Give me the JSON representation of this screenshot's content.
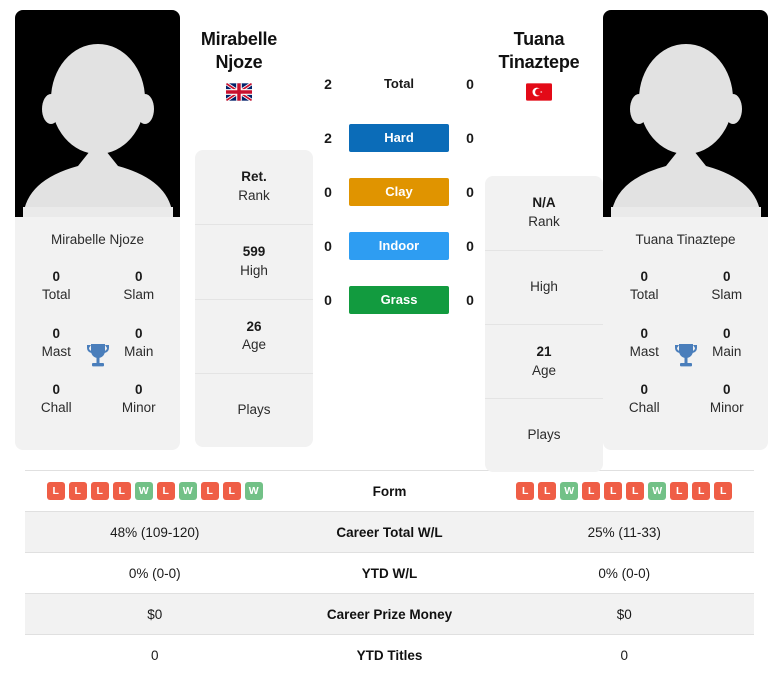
{
  "players": {
    "left": {
      "headline_name": "Mirabelle Njoze",
      "card_name": "Mirabelle Njoze",
      "flag": "gb-flag-icon",
      "flag_country": "United Kingdom",
      "avatar": "player-avatar-placeholder",
      "titles": [
        {
          "value": "0",
          "label": "Total"
        },
        {
          "value": "0",
          "label": "Slam"
        },
        {
          "value": "0",
          "label": "Mast"
        },
        {
          "value": "0",
          "label": "Main"
        },
        {
          "value": "0",
          "label": "Chall"
        },
        {
          "value": "0",
          "label": "Minor"
        }
      ],
      "rank_rows": [
        {
          "value": "Ret.",
          "label": "Rank"
        },
        {
          "value": "599",
          "label": "High"
        },
        {
          "value": "26",
          "label": "Age"
        },
        {
          "value": "",
          "label": "Plays"
        }
      ]
    },
    "right": {
      "headline_name": "Tuana Tinaztepe",
      "card_name": "Tuana Tinaztepe",
      "flag": "tr-flag-icon",
      "flag_country": "Turkey",
      "avatar": "player-avatar-placeholder",
      "titles": [
        {
          "value": "0",
          "label": "Total"
        },
        {
          "value": "0",
          "label": "Slam"
        },
        {
          "value": "0",
          "label": "Mast"
        },
        {
          "value": "0",
          "label": "Main"
        },
        {
          "value": "0",
          "label": "Chall"
        },
        {
          "value": "0",
          "label": "Minor"
        }
      ],
      "rank_rows": [
        {
          "value": "N/A",
          "label": "Rank"
        },
        {
          "value": "",
          "label": "High"
        },
        {
          "value": "21",
          "label": "Age"
        },
        {
          "value": "",
          "label": "Plays"
        }
      ]
    }
  },
  "surfaces": [
    {
      "label": "Total",
      "left": "2",
      "right": "0",
      "color": "transparent",
      "text_color": "#1a1a1a"
    },
    {
      "label": "Hard",
      "left": "2",
      "right": "0",
      "color": "#0b6cb8",
      "text_color": "#ffffff"
    },
    {
      "label": "Clay",
      "left": "0",
      "right": "0",
      "color": "#e09400",
      "text_color": "#ffffff"
    },
    {
      "label": "Indoor",
      "left": "0",
      "right": "0",
      "color": "#2e9df2",
      "text_color": "#ffffff"
    },
    {
      "label": "Grass",
      "left": "0",
      "right": "0",
      "color": "#129b3f",
      "text_color": "#ffffff"
    }
  ],
  "trophy_icon": "trophy-icon",
  "trophy_color": "#4a7ebb",
  "stat_rows": [
    {
      "label": "Form",
      "type": "form",
      "left_form": [
        "L",
        "L",
        "L",
        "L",
        "W",
        "L",
        "W",
        "L",
        "L",
        "W"
      ],
      "right_form": [
        "L",
        "L",
        "W",
        "L",
        "L",
        "L",
        "W",
        "L",
        "L",
        "L"
      ],
      "left": "",
      "right": ""
    },
    {
      "label": "Career Total W/L",
      "type": "text",
      "left": "48% (109-120)",
      "right": "25% (11-33)"
    },
    {
      "label": "YTD W/L",
      "type": "text",
      "left": "0% (0-0)",
      "right": "0% (0-0)"
    },
    {
      "label": "Career Prize Money",
      "type": "text",
      "left": "$0",
      "right": "$0"
    },
    {
      "label": "YTD Titles",
      "type": "text",
      "left": "0",
      "right": "0"
    }
  ],
  "colors": {
    "win_badge": "#72c187",
    "loss_badge": "#ef5e46",
    "card_bg": "#f2f2f2",
    "row_shade": "#f2f2f2"
  }
}
